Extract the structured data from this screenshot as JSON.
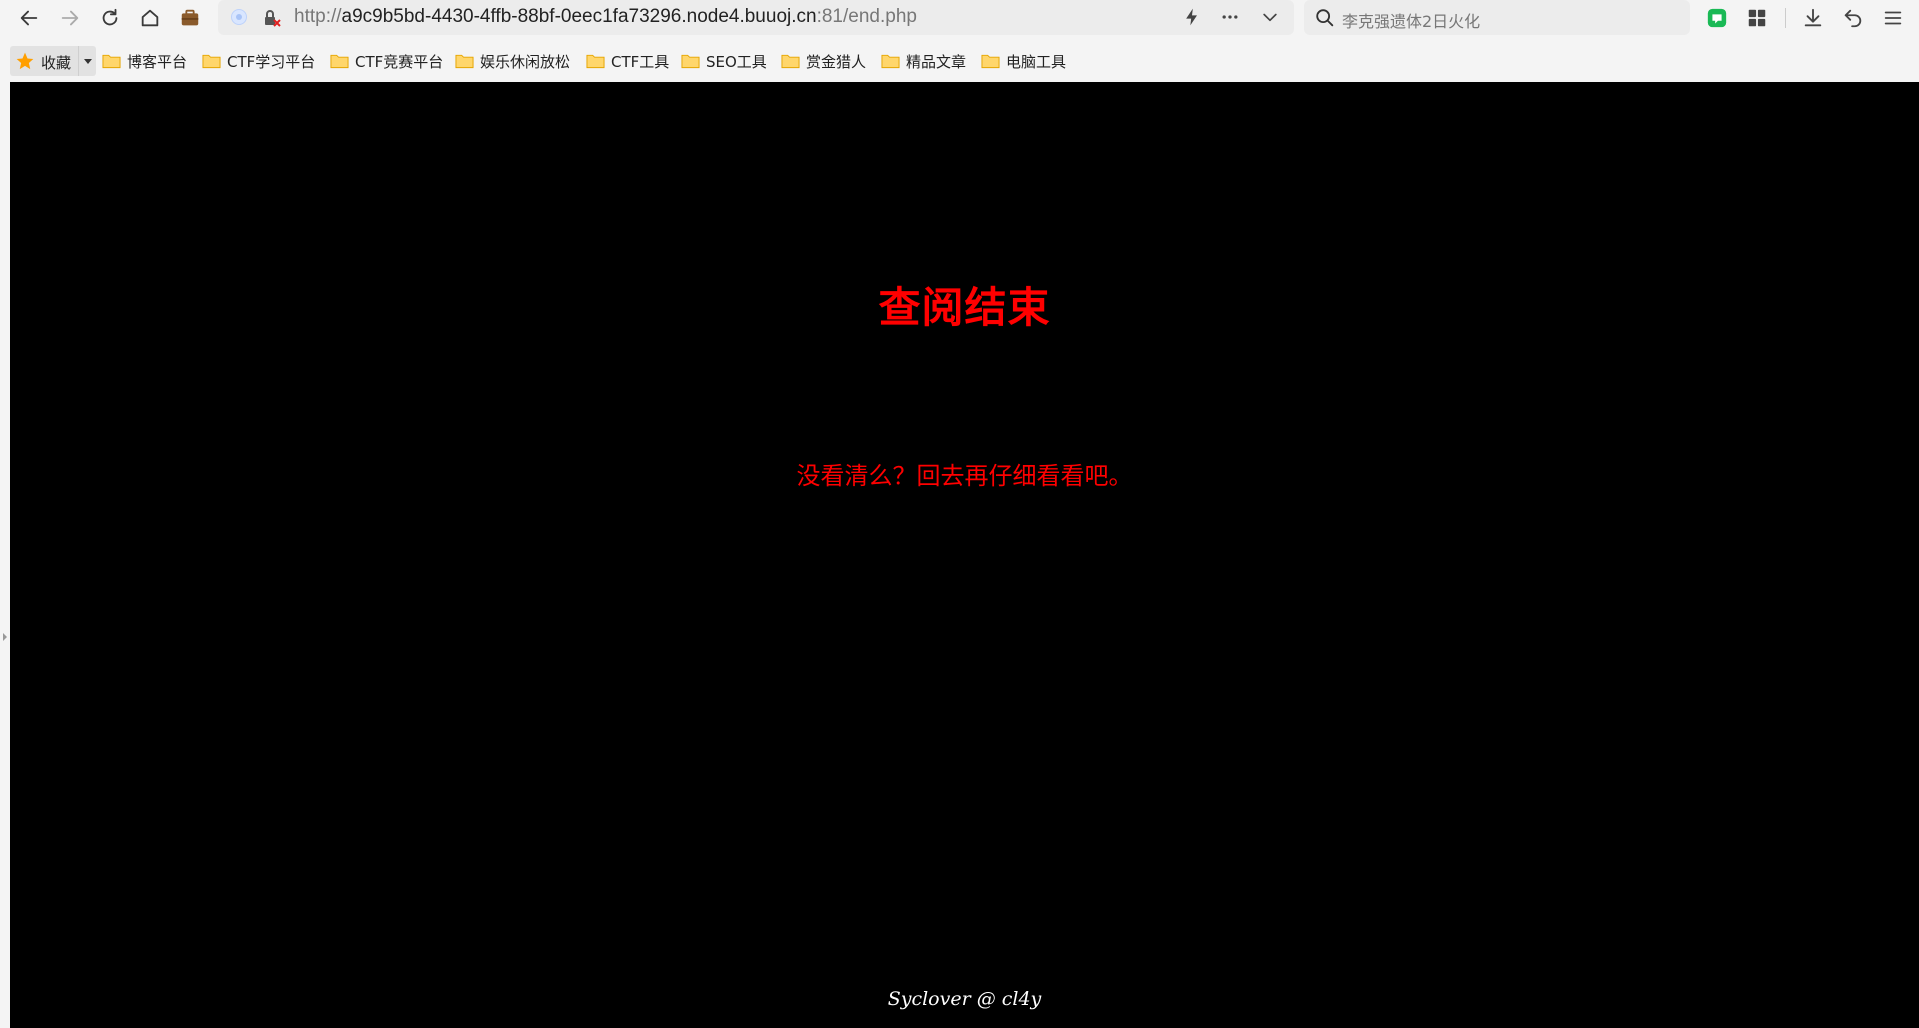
{
  "browser": {
    "url": {
      "scheme": "http://",
      "host": "a9c9b5bd-4430-4ffb-88bf-0eec1fa73296.node4.buuoj.cn",
      "rest": ":81/end.php"
    },
    "search_placeholder": "李克强遗体2日火化",
    "toolbar_icons": [
      "back-icon",
      "forward-icon",
      "reload-icon",
      "home-icon",
      "briefcase-icon",
      "lightning-icon",
      "more-icon",
      "dropdown-icon",
      "search-icon",
      "wechat-icon",
      "apps-grid-icon",
      "download-icon",
      "undo-icon",
      "menu-icon"
    ],
    "accent_color": "#ff9f00"
  },
  "bookmarks": {
    "favorites_label": "收藏",
    "items": [
      {
        "label": "博客平台"
      },
      {
        "label": "CTF学习平台"
      },
      {
        "label": "CTF竞赛平台"
      },
      {
        "label": "娱乐休闲放松"
      },
      {
        "label": "CTF工具"
      },
      {
        "label": "SEO工具"
      },
      {
        "label": "赏金猎人"
      },
      {
        "label": "精品文章"
      },
      {
        "label": "电脑工具"
      }
    ]
  },
  "page": {
    "title": "查阅结束",
    "message": "没看清么？回去再仔细看看吧。",
    "footer": "Syclover @ cl4y",
    "background": "#000000",
    "text_color": "#ff0000"
  }
}
